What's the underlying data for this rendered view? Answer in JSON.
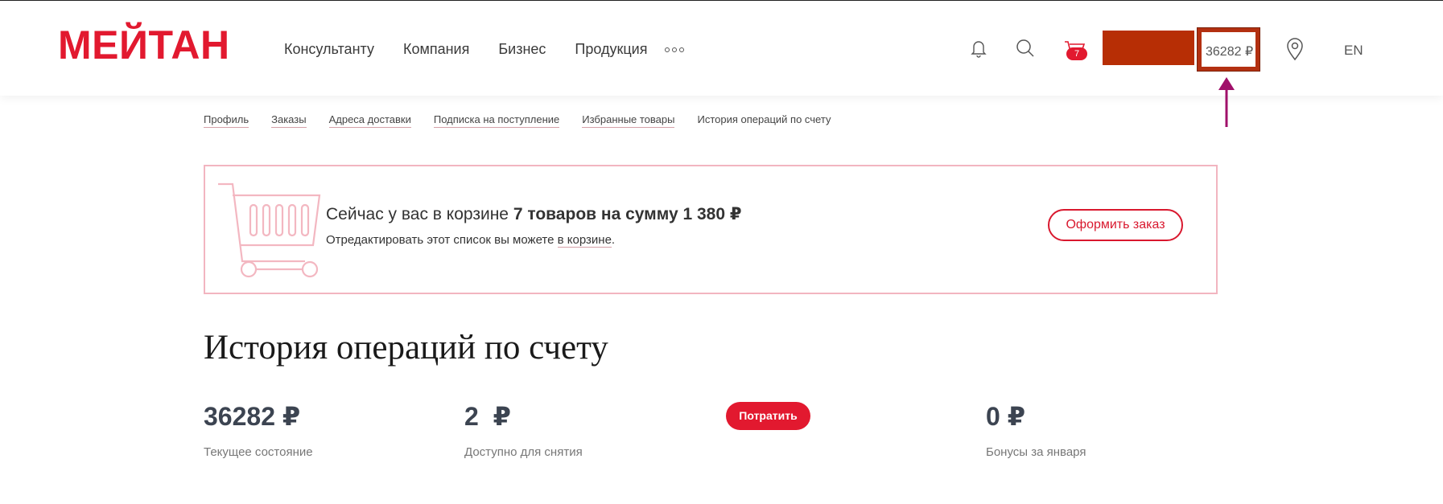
{
  "header": {
    "logo": "МЕЙТАН",
    "nav": [
      "Консультанту",
      "Компания",
      "Бизнес",
      "Продукция"
    ],
    "more_icon": "more-dots-icon",
    "cart_badge": "7",
    "balance": "36282 ₽",
    "language": "EN",
    "colors": {
      "brand": "#e2192f",
      "highlight": "#b33011",
      "arrow": "#a0106a"
    }
  },
  "breadcrumbs": [
    "Профиль",
    "Заказы",
    "Адреса доставки",
    "Подписка на поступление",
    "Избранные товары",
    "История операций по счету"
  ],
  "cart_banner": {
    "text_prefix": "Сейчас у вас в корзине",
    "text_bold": "7 товаров на сумму 1 380 ₽",
    "edit_prefix": "Отредактировать этот список вы можете",
    "edit_link": "в корзине",
    "edit_suffix": ".",
    "order_button": "Оформить заказ"
  },
  "page_title": "История операций по счету",
  "stats": {
    "current": {
      "value": "36282 ₽",
      "label": "Текущее состояние"
    },
    "available": {
      "value": "2  ₽",
      "label": "Доступно для снятия"
    },
    "spend_button": "Потратить",
    "bonuses": {
      "value": "0 ₽",
      "label": "Бонусы за января"
    }
  }
}
